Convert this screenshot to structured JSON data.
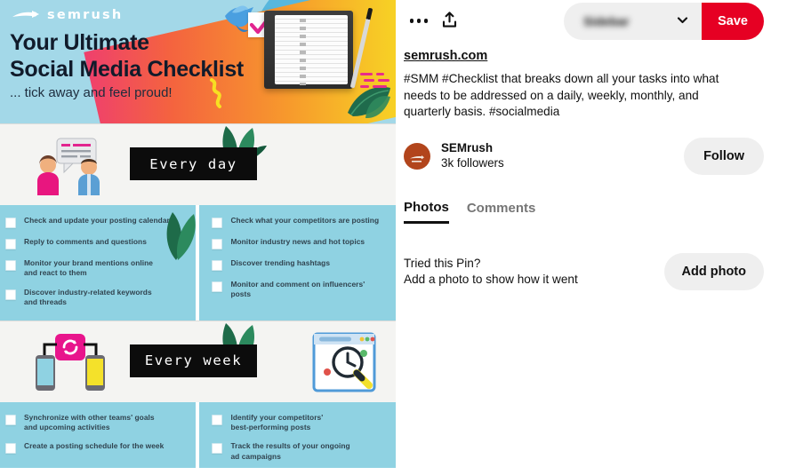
{
  "colors": {
    "brand_red": "#e60023",
    "hero_blue": "#a3d8e8",
    "hero_circle_blue": "#58b7dd",
    "panel_blue": "#8fd2e2",
    "tag_black": "#0c0c0c",
    "avatar_orange": "#b2451c",
    "button_grey": "#efefef"
  },
  "detail": {
    "more_options_icon": "more-horizontal-icon",
    "share_icon": "share-upload-icon",
    "board_selector": {
      "value": "Sidebar",
      "blurred": true,
      "chevron_icon": "chevron-down-icon"
    },
    "save_label": "Save",
    "source_link": "semrush.com",
    "description": "#SMM #Checklist that breaks down all your tasks into what needs to be addressed on a daily, weekly, monthly, and quarterly basis. #socialmedia",
    "profile": {
      "name": "SEMrush",
      "followers": "3k followers",
      "follow_label": "Follow",
      "avatar_icon": "semrush-logo-avatar"
    },
    "tabs": [
      {
        "label": "Photos",
        "active": true
      },
      {
        "label": "Comments",
        "active": false
      }
    ],
    "tried": {
      "text": "Tried this Pin?\nAdd a photo to show how it went",
      "button_label": "Add photo"
    }
  },
  "infographic": {
    "logo_text": "semrush",
    "title": "Your Ultimate\nSocial Media Checklist",
    "subtitle": "... tick away and feel proud!",
    "sections": [
      {
        "tag": "Every day",
        "left_icon": "people-chat-icon",
        "right_icon": "",
        "columns": [
          {
            "items": [
              "Check and update your posting calendar",
              "Reply to comments and questions",
              "Monitor your brand mentions online\nand react to them",
              "Discover industry-related keywords\nand threads"
            ]
          },
          {
            "items": [
              "Check what your competitors are posting",
              "Monitor industry news and hot topics",
              "Discover trending hashtags",
              "Monitor and comment on influencers'\nposts"
            ]
          }
        ]
      },
      {
        "tag": "Every week",
        "left_icon": "phones-sync-icon",
        "right_icon": "browser-search-icon",
        "columns": [
          {
            "items": [
              "Synchronize with other teams' goals\nand upcoming activities",
              "Create a posting schedule for the week"
            ]
          },
          {
            "items": [
              "Identify your competitors'\nbest-performing posts",
              "Track the results of your ongoing\nad campaigns"
            ]
          }
        ]
      }
    ]
  }
}
